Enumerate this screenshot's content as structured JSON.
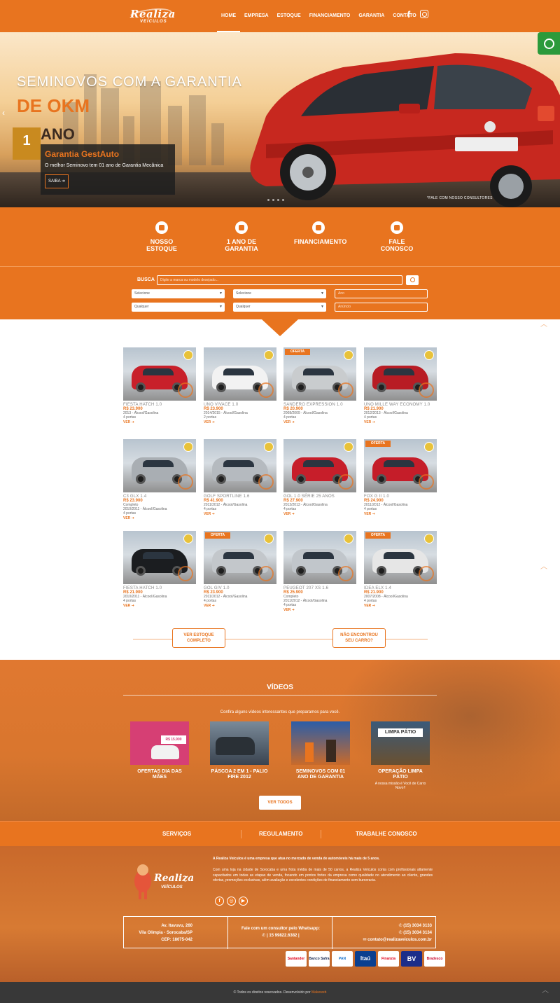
{
  "header": {
    "logo_line1": "Realiza",
    "logo_line2": "VEÍCULOS",
    "nav": [
      "HOME",
      "EMPRESA",
      "ESTOQUE",
      "FINANCIAMENTO",
      "GARANTIA",
      "CONTATO"
    ],
    "active_nav": "HOME",
    "social_icons": [
      "facebook-icon",
      "instagram-icon"
    ]
  },
  "hero": {
    "title_line1": "SEMINOVOS COM A GARANTIA",
    "title_line2": "DE OKM",
    "badge_number": "1",
    "badge_word": "ANO",
    "box_title": "Garantia GestAuto",
    "box_subtitle": "O melhor Seminovo tem 01 ano de Garantia Mecânica",
    "box_button": "SAIBA ➜",
    "note": "*FALE COM NOSSO CONSULTORES",
    "brand_color": "#e8741f"
  },
  "features": [
    {
      "icon": "car-icon",
      "label": "NOSSO ESTOQUE"
    },
    {
      "icon": "diamond-icon",
      "label": "1 ANO DE GARANTIA"
    },
    {
      "icon": "diamond-icon",
      "label": "FINANCIAMENTO"
    },
    {
      "icon": "phone-icon",
      "label": "FALE CONOSCO"
    }
  ],
  "search": {
    "label": "BUSCA",
    "placeholder": "Digite a marca ou modelo desejado...",
    "select1": "Selecione",
    "select2": "Selecione",
    "select3": "Qualquer",
    "select4": "Qualquer",
    "input_ano": "Ano",
    "input_anuncio": "Anúncio"
  },
  "cars": [
    {
      "name": "FIESTA HATCH 1.0",
      "price": "R$ 23.900",
      "details": "2013 - Álcool/Gasolina",
      "extra": "4 portas",
      "badge": "",
      "color": "#c8202a"
    },
    {
      "name": "UNO VIVACE 1.0",
      "price": "R$ 23.900",
      "details": "2014/2015 - Álcool/Gasolina",
      "extra": "2 portas",
      "badge": "",
      "color": "#f2f2f2"
    },
    {
      "name": "SANDERO EXPRESSION 1.0",
      "price": "R$ 20.900",
      "details": "2008/2009 - Álcool/Gasolina",
      "extra": "4 portas",
      "badge": "OFERTA",
      "color": "#c9ccce"
    },
    {
      "name": "UNO MILLE WAY ECONOMY 1.0",
      "price": "R$ 21.900",
      "details": "2012/2013 - Álcool/Gasolina",
      "extra": "4 portas",
      "badge": "",
      "color": "#b81c24"
    },
    {
      "name": "C3 GLX 1.4",
      "price": "R$ 23.900",
      "details": "Completo",
      "extra": "2010/2011 - Álcool/Gasolina",
      "extra2": "4 portas",
      "badge": "",
      "color": "#a9aeb3"
    },
    {
      "name": "GOLF SPORTLINE 1.6",
      "price": "R$ 41.900",
      "details": "2011/2012 - Álcool/Gasolina",
      "extra": "4 portas",
      "badge": "",
      "color": "#b5babf"
    },
    {
      "name": "GOL 1.0 SÉRIE 25 ANOS",
      "price": "R$ 27.900",
      "details": "2012/2013 - Álcool/Gasolina",
      "extra": "4 portas",
      "badge": "",
      "color": "#c71e2a"
    },
    {
      "name": "FOX G II 1.0",
      "price": "R$ 24.900",
      "details": "2011/2012 - Álcool/Gasolina",
      "extra": "4 portas",
      "badge": "OFERTA",
      "color": "#c51d29"
    },
    {
      "name": "FIESTA HATCH 1.0",
      "price": "R$ 21.900",
      "details": "2010/2011 - Álcool/Gasolina",
      "extra": "4 portas",
      "badge": "",
      "color": "#1b1d20"
    },
    {
      "name": "GOL GIV 1.0",
      "price": "R$ 23.900",
      "details": "2011/2012 - Álcool/Gasolina",
      "extra": "4 portas",
      "badge": "OFERTA",
      "color": "#c3c7cb"
    },
    {
      "name": "PEUGEOT 207 XS 1.6",
      "price": "R$ 25.900",
      "details": "Completo",
      "extra": "2011/2012 - Álcool/Gasolina",
      "extra2": "4 portas",
      "badge": "",
      "color": "#c1c6cb"
    },
    {
      "name": "IDEA ELX 1.4",
      "price": "R$ 21.900",
      "details": "2007/2008 - Álcool/Gasolina",
      "extra": "4 portas",
      "badge": "OFERTA",
      "color": "#e6e6e6"
    }
  ],
  "view_label": "VER ➜",
  "listing_buttons": {
    "stock_line1": "VER ESTOQUE",
    "stock_line2": "COMPLETO",
    "notfound_line1": "NÃO ENCONTROU",
    "notfound_line2": "SEU CARRO?"
  },
  "videos": {
    "title": "VÍDEOS",
    "subtitle": "Confira alguns vídeos interessantes que preparamos para você.",
    "items": [
      {
        "caption": "OFERTAS DIA DAS MÃES",
        "caption2": "",
        "thumb": "#d63f74",
        "price": "R$ 15.900"
      },
      {
        "caption": "PÁSCOA 2 EM 1 - PALIO FIRE 2012",
        "caption2": "",
        "thumb": "#3a4450"
      },
      {
        "caption": "SEMINOVOS COM 01 ANO DE GARANTIA",
        "caption2": "",
        "thumb": "#c96a2a"
      },
      {
        "caption": "OPERAÇÃO LIMPA PÁTIO",
        "caption2": "A nossa missão é Você de Carro Novo!!",
        "thumb": "#6a5030",
        "thumb_text": "LIMPA PÁTIO"
      }
    ],
    "button": "VER TODOS"
  },
  "linkbar": [
    "SERVIÇOS",
    "REGULAMENTO",
    "TRABALHE CONOSCO"
  ],
  "footer": {
    "intro": "A Realiza Veículos é uma empresa que atua no mercado de venda de automóveis há mais de 5 anos.",
    "body": "Com uma loja na cidade de Sorocaba e uma frota média de mais de 50 carros, a Realiza Veículos conta com profissionais altamente capacitados em todas as etapas de venda, focando em pontos fortes da empresa como qualidade no atendimento ao cliente, grandes ofertas, promoções exclusivas, além avaliação e excelentes condições de financiamento sem burocracia.",
    "social": [
      "f",
      "◎",
      "▶"
    ],
    "address1": "Av. Itavuvu, 260",
    "address2": "Vila Olímpia - Sorocaba/SP",
    "address3": "CEP: 18075-042",
    "whats_label": "Fale com um consultor pelo Whatsapp:",
    "whats_number": "✆ | 15 99822.6382 |",
    "phone1": "✆ (15) 3034 3133",
    "phone2": "✆ (15) 3034 3134",
    "email": "✉ contato@realizaveiculos.com.br",
    "banks": [
      "Santander",
      "Banco Safra",
      "PAN",
      "Itaú",
      "Finanzia",
      "BV",
      "Bradesco"
    ],
    "copyright": "© Todos os direitos reservados. Desenvolvido por ",
    "developer": "Makeweb"
  }
}
